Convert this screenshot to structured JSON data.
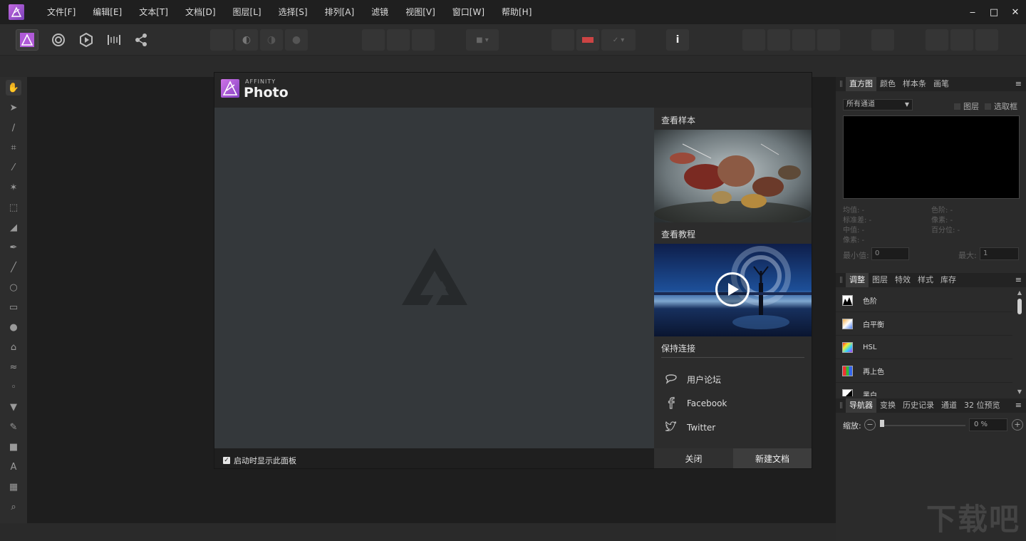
{
  "app": {
    "menu": [
      "文件[F]",
      "编辑[E]",
      "文本[T]",
      "文档[D]",
      "图层[L]",
      "选择[S]",
      "排列[A]",
      "滤镜",
      "视图[V]",
      "窗口[W]",
      "帮助[H]"
    ],
    "accent": "#b05ad8"
  },
  "splash": {
    "brand_small": "AFFINITY",
    "brand": "Photo",
    "samples_heading": "查看样本",
    "tutorials_heading": "查看教程",
    "connect_heading": "保持连接",
    "links": [
      "用户论坛",
      "Facebook",
      "Twitter"
    ],
    "startup_label": "启动时显示此面板",
    "startup_checked": true,
    "close_label": "关闭",
    "new_doc_label": "新建文档"
  },
  "histogram_panel": {
    "tabs": [
      "直方图",
      "颜色",
      "样本条",
      "画笔"
    ],
    "channel_select": "所有通道",
    "check_layer": "图层",
    "check_selection": "选取框",
    "stats_left": [
      "均值: -",
      "标准差: -",
      "中值: -",
      "像素: -"
    ],
    "stats_right": [
      "色阶: -",
      "像素: -",
      "百分位: -"
    ],
    "min_label": "最小值:",
    "min_value": "0",
    "max_label": "最大:",
    "max_value": "1"
  },
  "adjust_panel": {
    "tabs": [
      "调整",
      "图层",
      "特效",
      "样式",
      "库存"
    ],
    "items": [
      "色阶",
      "白平衡",
      "HSL",
      "再上色",
      "黑白"
    ]
  },
  "navigator_panel": {
    "tabs": [
      "导航器",
      "变换",
      "历史记录",
      "通道",
      "32 位预览"
    ],
    "zoom_label": "缩放:",
    "zoom_value": "0 %",
    "zoom_level": 0
  },
  "watermark": "下载吧"
}
